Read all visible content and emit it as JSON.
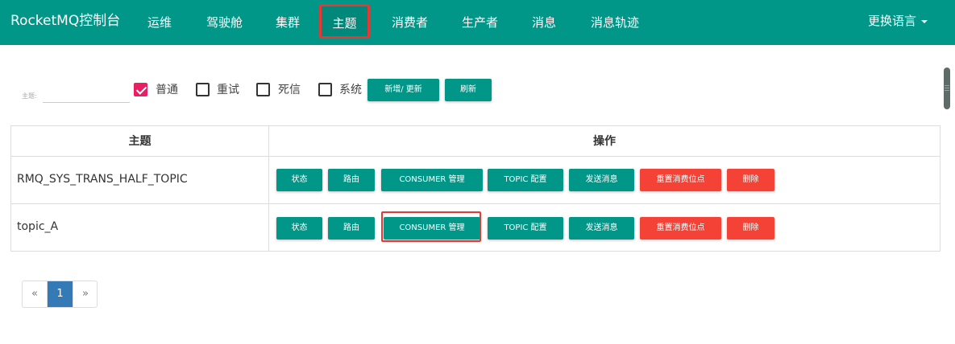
{
  "navbar": {
    "brand": "RocketMQ控制台",
    "items": [
      {
        "label": "运维"
      },
      {
        "label": "驾驶舱"
      },
      {
        "label": "集群"
      },
      {
        "label": "主题"
      },
      {
        "label": "消费者"
      },
      {
        "label": "生产者"
      },
      {
        "label": "消息"
      },
      {
        "label": "消息轨迹"
      }
    ],
    "active_index": 3,
    "language": "更换语言"
  },
  "filter": {
    "topic_label": "主题:",
    "topic_value": "",
    "checkboxes": [
      {
        "label": "普通",
        "checked": true
      },
      {
        "label": "重试",
        "checked": false
      },
      {
        "label": "死信",
        "checked": false
      },
      {
        "label": "系统",
        "checked": false
      }
    ],
    "add_update_label": "新增/ 更新",
    "refresh_label": "刷新"
  },
  "table": {
    "headers": [
      "主题",
      "操作"
    ],
    "actions": [
      "状态",
      "路由",
      "CONSUMER 管理",
      "TOPIC 配置",
      "发送消息",
      "重置消费位点",
      "删除"
    ],
    "rows": [
      {
        "topic": "RMQ_SYS_TRANS_HALF_TOPIC"
      },
      {
        "topic": "topic_A"
      }
    ]
  },
  "pagination": {
    "prev": "«",
    "current": "1",
    "next": "»"
  },
  "colors": {
    "primary": "#009688",
    "danger": "#f44336",
    "highlight": "#e53935",
    "checkbox_checked": "#e91e63",
    "page_active": "#337ab7"
  }
}
